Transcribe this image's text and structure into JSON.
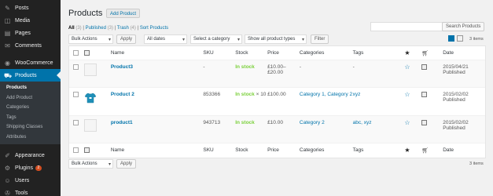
{
  "sidebar": {
    "items_top": [
      {
        "icon": "pin-icon",
        "glyph": "✎",
        "label": "Posts"
      },
      {
        "icon": "media-icon",
        "glyph": "◫",
        "label": "Media"
      },
      {
        "icon": "pages-icon",
        "glyph": "▤",
        "label": "Pages"
      },
      {
        "icon": "comments-icon",
        "glyph": "✉",
        "label": "Comments"
      }
    ],
    "woocommerce": {
      "icon": "woocommerce-icon",
      "glyph": "◉",
      "label": "WooCommerce"
    },
    "products": {
      "icon": "products-icon",
      "glyph": "🛒",
      "label": "Products"
    },
    "submenu": [
      "Products",
      "Add Product",
      "Categories",
      "Tags",
      "Shipping Classes",
      "Attributes"
    ],
    "items_bottom": [
      {
        "icon": "appearance-icon",
        "glyph": "✐",
        "label": "Appearance"
      },
      {
        "icon": "plugins-icon",
        "glyph": "⚙",
        "label": "Plugins",
        "badge": "2"
      },
      {
        "icon": "users-icon",
        "glyph": "☺",
        "label": "Users"
      },
      {
        "icon": "tools-icon",
        "glyph": "✇",
        "label": "Tools"
      }
    ]
  },
  "header": {
    "title": "Products",
    "add_new": "Add Product"
  },
  "filters_links": {
    "all": "All",
    "all_count": "(3)",
    "published": "Published",
    "published_count": "(3)",
    "trash": "Trash",
    "trash_count": "(4)",
    "sort": "Sort Products"
  },
  "search": {
    "button": "Search Products"
  },
  "toolbar": {
    "bulk_actions": "Bulk Actions",
    "apply": "Apply",
    "all_dates": "All dates",
    "category": "Select a category",
    "product_types": "Show all product types",
    "filter": "Filter",
    "items_count": "3 items"
  },
  "table": {
    "headers": {
      "name": "Name",
      "sku": "SKU",
      "stock": "Stock",
      "price": "Price",
      "categories": "Categories",
      "tags": "Tags",
      "date": "Date"
    },
    "rows": [
      {
        "name": "Product3",
        "sku": "-",
        "stock": "In stock",
        "stock_qty": "",
        "price": "£10.00–£20.00",
        "categories": "-",
        "tags": "-",
        "date": "2015/04/21",
        "status": "Published",
        "thumb": "placeholder"
      },
      {
        "name": "Product 2",
        "sku": "853366",
        "stock": "In stock",
        "stock_qty": "× 10",
        "price": "£100.00",
        "categories": "Category 1, Category 2",
        "tags": "xyz",
        "date": "2015/02/02",
        "status": "Published",
        "thumb": "tshirt"
      },
      {
        "name": "product1",
        "sku": "943713",
        "stock": "In stock",
        "stock_qty": "",
        "price": "£10.00",
        "categories": "Category 2",
        "tags": "abc, xyz",
        "date": "2015/02/02",
        "status": "Published",
        "thumb": "placeholder"
      }
    ]
  },
  "colors": {
    "accent": "#0073aa",
    "instock": "#7ad03a",
    "sidebar": "#222222"
  }
}
